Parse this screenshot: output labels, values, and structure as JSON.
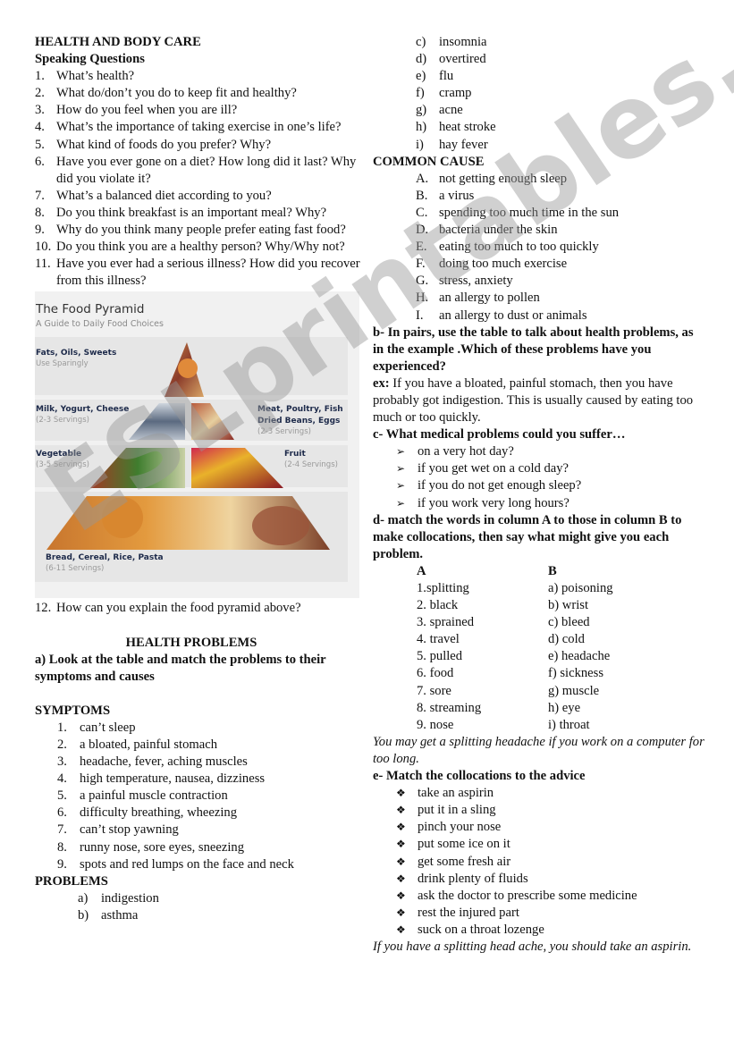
{
  "title": "HEALTH AND BODY CARE",
  "speaking": {
    "heading": "Speaking Questions",
    "questions": [
      {
        "n": "1.",
        "t": "What’s health?"
      },
      {
        "n": "2.",
        "t": "What do/don’t you do to keep fit and healthy?"
      },
      {
        "n": "3.",
        "t": "How do you feel when you are ill?"
      },
      {
        "n": "4.",
        "t": "What’s the importance of taking exercise in one’s life?"
      },
      {
        "n": "5.",
        "t": "What kind of foods do you prefer? Why?"
      },
      {
        "n": "6.",
        "t": "Have you ever gone on a diet? How long did it last? Why did you violate it?"
      },
      {
        "n": "7.",
        "t": "What’s a balanced diet according to you?"
      },
      {
        "n": "8.",
        "t": "Do you think breakfast is an important meal? Why?"
      },
      {
        "n": "9.",
        "t": "Why do you think many people prefer eating fast food?"
      },
      {
        "n": "10.",
        "t": "Do you think you are a healthy person? Why/Why not?"
      },
      {
        "n": "11.",
        "t": "Have you ever had a serious illness? How did you recover from this illness?"
      }
    ],
    "q12": {
      "n": "12.",
      "t": "How can you explain the food pyramid above?"
    }
  },
  "pyramid": {
    "title": "The Food Pyramid",
    "subtitle": "A Guide to Daily Food Choices",
    "groups": {
      "fats": {
        "name": "Fats, Oils, Sweets",
        "servings": "Use Sparingly"
      },
      "milk": {
        "name": "Milk, Yogurt, Cheese",
        "servings": "(2-3 Servings)"
      },
      "meat": {
        "name1": "Meat, Poultry, Fish",
        "name2": "Dried Beans, Eggs",
        "servings": "(2-3 Servings)"
      },
      "veg": {
        "name": "Vegetable",
        "servings": "(3-5 Servings)"
      },
      "fruit": {
        "name": "Fruit",
        "servings": "(2-4 Servings)"
      },
      "bread": {
        "name": "Bread, Cereal, Rice, Pasta",
        "servings": "(6-11 Servings)"
      }
    }
  },
  "health_problems": {
    "heading": "HEALTH PROBLEMS",
    "task_a": "a) Look at the table and match the problems to their symptoms and causes",
    "symptoms_heading": "SYMPTOMS",
    "symptoms": [
      {
        "n": "1.",
        "t": "can’t sleep"
      },
      {
        "n": "2.",
        "t": "a bloated, painful stomach"
      },
      {
        "n": "3.",
        "t": "headache, fever, aching muscles"
      },
      {
        "n": "4.",
        "t": "high temperature, nausea, dizziness"
      },
      {
        "n": "5.",
        "t": "a painful muscle contraction"
      },
      {
        "n": "6.",
        "t": "difficulty breathing, wheezing"
      },
      {
        "n": "7.",
        "t": "can’t stop yawning"
      },
      {
        "n": "8.",
        "t": "runny nose, sore eyes, sneezing"
      },
      {
        "n": "9.",
        "t": "spots and red lumps on the face and neck"
      }
    ],
    "problems_heading": "PROBLEMS",
    "problems": [
      {
        "n": "a)",
        "t": "indigestion"
      },
      {
        "n": "b)",
        "t": "asthma"
      },
      {
        "n": "c)",
        "t": "insomnia"
      },
      {
        "n": "d)",
        "t": "overtired"
      },
      {
        "n": "e)",
        "t": "flu"
      },
      {
        "n": "f)",
        "t": "cramp"
      },
      {
        "n": "g)",
        "t": "acne"
      },
      {
        "n": "h)",
        "t": "heat stroke"
      },
      {
        "n": "i)",
        "t": "hay fever"
      }
    ],
    "causes_heading": "COMMON CAUSE",
    "causes": [
      {
        "n": "A.",
        "t": "not getting enough sleep"
      },
      {
        "n": "B.",
        "t": "a virus"
      },
      {
        "n": "C.",
        "t": "spending too much time in the sun"
      },
      {
        "n": "D.",
        "t": "bacteria under the skin"
      },
      {
        "n": "E.",
        "t": "eating too much to too quickly"
      },
      {
        "n": "F.",
        "t": "doing too much exercise"
      },
      {
        "n": "G.",
        "t": "stress, anxiety"
      },
      {
        "n": "H.",
        "t": "an allergy to pollen"
      },
      {
        "n": "I.",
        "t": "an allergy to dust or animals"
      }
    ]
  },
  "task_b": {
    "instruction": "b- In pairs, use the table to talk about health problems, as in the example .Which of these problems have you experienced?",
    "ex_label": "ex:",
    "ex_text": " If you have a bloated, painful stomach, then you have probably got indigestion. This is usually caused by eating too much or too quickly."
  },
  "task_c": {
    "instruction": "c- What medical problems could you suffer…",
    "bullet": "➢",
    "items": [
      "on a very hot day?",
      "if you get wet on a cold day?",
      "if you do not get enough sleep?",
      "if you work very long hours?"
    ]
  },
  "task_d": {
    "instruction": "d- match the words in column A to those in column B to make collocations, then say what might give you each problem.",
    "col_a_header": "A",
    "col_b_header": "B",
    "col_a": [
      "1.splitting",
      "2. black",
      "3. sprained",
      "4. travel",
      "5. pulled",
      "6. food",
      "7. sore",
      "8. streaming",
      "9. nose"
    ],
    "col_b": [
      "a) poisoning",
      "b) wrist",
      "c) bleed",
      "d) cold",
      "e) headache",
      "f) sickness",
      "g) muscle",
      "h) eye",
      "i) throat"
    ],
    "example": "You may get a splitting headache if you work on a computer for too long."
  },
  "task_e": {
    "instruction": "e- Match the collocations to the advice",
    "bullet": "❖",
    "items": [
      "take an aspirin",
      "put it in a sling",
      "pinch your nose",
      "put some ice on it",
      "get some fresh air",
      "drink plenty of fluids",
      "ask the doctor to prescribe some medicine",
      "rest the injured part",
      "suck on a throat lozenge"
    ],
    "example": "If you have a splitting head ache, you should take an aspirin."
  },
  "watermark": "ESLprintables.com"
}
